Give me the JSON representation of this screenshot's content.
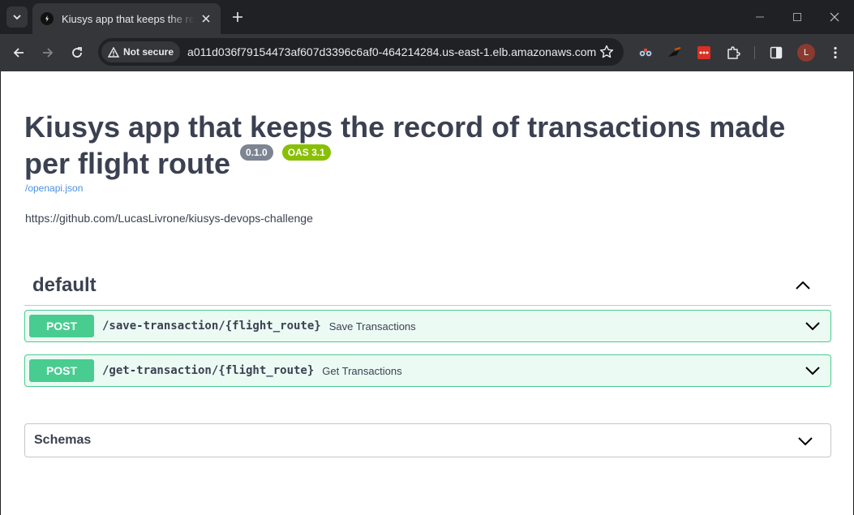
{
  "browser": {
    "tab": {
      "title": "Kiusys app that keeps the record of transactions made per flight route",
      "favicon": "swagger-icon"
    },
    "security_label": "Not secure",
    "url": "a011d036f79154473af607d3396c6af0-464214284.us-east-1.elb.amazonaws.com",
    "profile_initial": "L",
    "extensions": [
      "binoculars-extension-icon",
      "ninja-extension-icon",
      "red-dots-extension-icon",
      "puzzle-extensions-icon",
      "side-panel-icon"
    ],
    "colors": {
      "frame": "#202124",
      "toolbar": "#35363a",
      "avatar": "#8b3a2f"
    }
  },
  "api": {
    "title": "Kiusys app that keeps the record of transactions made per flight route",
    "version": "0.1.0",
    "oas": "OAS 3.1",
    "spec_link": "/openapi.json",
    "description": "https://github.com/LucasLivrone/kiusys-devops-challenge"
  },
  "tag": {
    "name": "default",
    "expanded": true
  },
  "operations": [
    {
      "method": "POST",
      "path": "/save-transaction/{flight_route}",
      "summary": "Save Transactions"
    },
    {
      "method": "POST",
      "path": "/get-transaction/{flight_route}",
      "summary": "Get Transactions"
    }
  ],
  "schemas": {
    "title": "Schemas",
    "expanded": false
  },
  "colors": {
    "post": "#49cc90",
    "text": "#3b4151",
    "version_badge": "#7d8492",
    "oas_badge": "#89bf04",
    "link": "#4990e2"
  }
}
